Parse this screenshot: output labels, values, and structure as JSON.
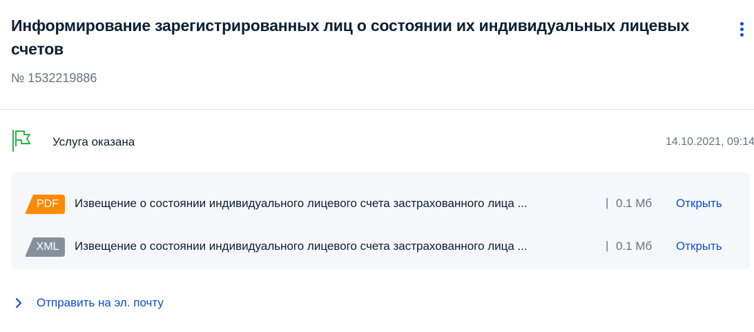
{
  "header": {
    "title": "Информирование зарегистрированных лиц о состоянии их индивидуальных лицевых счетов",
    "number": "№ 1532219886",
    "menu_icon": "more-vertical-icon"
  },
  "status": {
    "icon": "flag-icon",
    "text": "Услуга оказана",
    "date": "14.10.2021, 09:14",
    "icon_color": "#2bae4b"
  },
  "files": [
    {
      "type": "PDF",
      "badge_color": "#ff8a00",
      "name": "Извещение о состоянии индивидуального лицевого счета застрахованного лица ...",
      "separator": "|",
      "size": "0.1 Мб",
      "action": "Открыть"
    },
    {
      "type": "XML",
      "badge_color": "#86909c",
      "name": "Извещение о состоянии индивидуального лицевого счета застрахованного лица ...",
      "separator": "|",
      "size": "0.1 Мб",
      "action": "Открыть"
    }
  ],
  "send": {
    "icon": "chevron-right-icon",
    "label": "Отправить на эл. почту"
  },
  "colors": {
    "accent": "#0d4cd3",
    "text": "#0b1f33",
    "muted": "#66727f",
    "box_bg": "#f5f7fa"
  }
}
